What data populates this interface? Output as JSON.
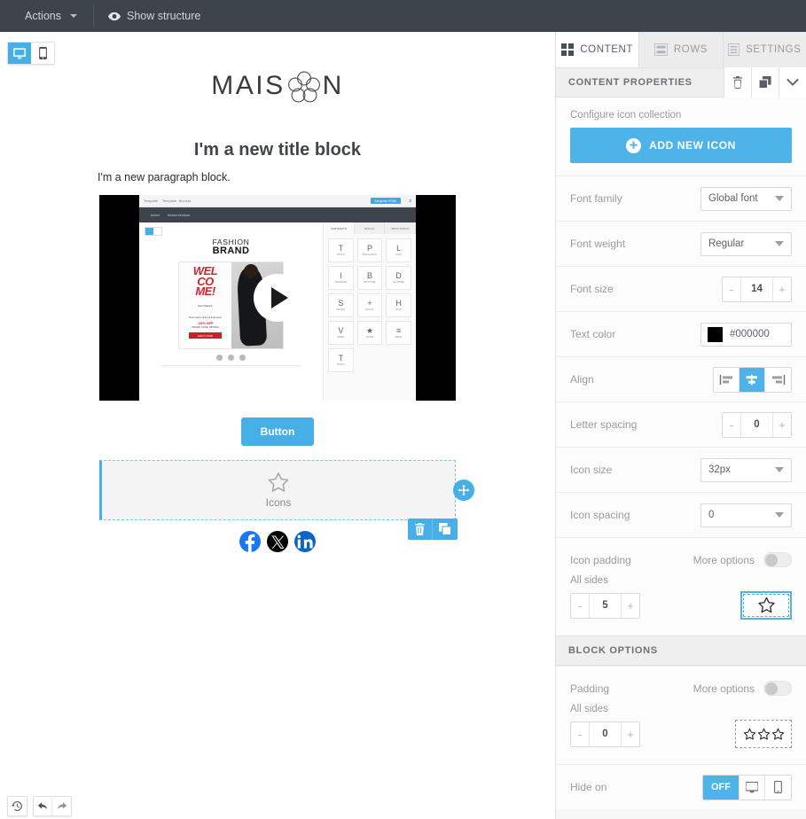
{
  "topbar": {
    "actions_label": "Actions",
    "show_structure_label": "Show structure",
    "actions_icon": "chevron-down-icon",
    "structure_icon": "eye-icon"
  },
  "canvas": {
    "device_toggle": {
      "desktop_label": "desktop-view",
      "mobile_label": "mobile-view",
      "active": "desktop"
    },
    "logo": {
      "text_left": "MAIS",
      "text_right": "N",
      "flower_icon": "flower-logo-icon"
    },
    "title_block": "I'm a new title block",
    "paragraph_block": "I'm a new paragraph block.",
    "video_block": {
      "play_icon": "play-button-icon",
      "inner": {
        "breadcrumb_back": "Template",
        "breadcrumb_current": "Template: Nicosia",
        "source_html_btn": "Sorgente HTML",
        "close_btn": "x",
        "menu_actions": "Azioni",
        "menu_structure": "Mostra struttura",
        "brand_line1": "FASHION",
        "brand_line2": "BRAND",
        "welcome_l1": "WEL",
        "welcome_l2": "CO",
        "welcome_l3": "ME!",
        "promo_sub1": "Dear #Name#,",
        "promo_sub2": "lorem ipsum dolor sit amet enim",
        "promo_off": "-10% OFF",
        "promo_code": "PROMO CODE: NIKOSIA",
        "promo_btn": "ENJOY NOW",
        "tabs": [
          {
            "label": "CONTENUTO",
            "icon": "grid-icon",
            "active": true
          },
          {
            "label": "MODULI",
            "icon": "rows-icon",
            "active": false
          },
          {
            "label": "IMPOSTAZIONI",
            "icon": "settings-icon",
            "active": false
          }
        ],
        "cells": [
          {
            "glyph": "T",
            "label": "TITOLO"
          },
          {
            "glyph": "P",
            "label": "PARAGRAFO"
          },
          {
            "glyph": "L",
            "label": "LISTA"
          },
          {
            "glyph": "I",
            "label": "IMMAGINE"
          },
          {
            "glyph": "B",
            "label": "BOTTONE"
          },
          {
            "glyph": "D",
            "label": "DIVISORE"
          },
          {
            "glyph": "S",
            "label": "SPAZIO"
          },
          {
            "glyph": "+",
            "label": "SOCIAL"
          },
          {
            "glyph": "H",
            "label": "HTML"
          },
          {
            "glyph": "V",
            "label": "VIDEO"
          },
          {
            "glyph": "★",
            "label": "ICONE"
          },
          {
            "glyph": "≡",
            "label": "MENU"
          },
          {
            "glyph": "T",
            "label": "TESTO"
          }
        ]
      }
    },
    "button_block": {
      "label": "Button"
    },
    "icons_block": {
      "placeholder_label": "Icons",
      "star_icon": "star-outline-icon",
      "drag_handle_icon": "move-handle-icon",
      "selected": true
    },
    "social_icons": [
      {
        "name": "facebook-icon",
        "color": "#1877F2"
      },
      {
        "name": "x-twitter-icon",
        "color": "#000000"
      },
      {
        "name": "linkedin-icon",
        "color": "#0A66C2"
      }
    ],
    "mini_toolbar": [
      {
        "name": "delete-block-button",
        "icon": "trash-icon"
      },
      {
        "name": "duplicate-block-button",
        "icon": "copy-icon"
      }
    ],
    "bottom_tools": [
      {
        "name": "history-button",
        "icon": "history-icon"
      },
      {
        "name": "undo-button",
        "icon": "undo-arrow-icon"
      },
      {
        "name": "redo-button",
        "icon": "redo-arrow-icon"
      }
    ]
  },
  "panel": {
    "tabs": [
      {
        "label": "CONTENT",
        "icon": "grid-icon",
        "active": true
      },
      {
        "label": "ROWS",
        "icon": "rows-icon",
        "active": false
      },
      {
        "label": "SETTINGS",
        "icon": "settings-icon",
        "active": false
      }
    ],
    "content_properties": {
      "header": "CONTENT PROPERTIES",
      "header_actions": [
        {
          "name": "delete-content-button",
          "icon": "trash-icon"
        },
        {
          "name": "duplicate-content-button",
          "icon": "copy-icon"
        },
        {
          "name": "collapse-section-button",
          "icon": "chevron-down-icon"
        }
      ],
      "configure_label": "Configure icon collection",
      "add_icon_button": "ADD NEW ICON",
      "add_icon_glyph": "plus-circle-icon",
      "rows": [
        {
          "label": "Font family",
          "type": "select",
          "value": "Global font"
        },
        {
          "label": "Font weight",
          "type": "select",
          "value": "Regular"
        },
        {
          "label": "Font size",
          "type": "stepper",
          "value": "14",
          "minus": "-",
          "plus": "+"
        },
        {
          "label": "Text color",
          "type": "color",
          "value": "#000000",
          "swatch": "#000000"
        },
        {
          "label": "Align",
          "type": "align",
          "value": "center",
          "options": [
            "align-left",
            "align-center",
            "align-right"
          ]
        },
        {
          "label": "Letter spacing",
          "type": "stepper",
          "value": "0",
          "minus": "-",
          "plus": "+"
        },
        {
          "label": "Icon size",
          "type": "select",
          "value": "32px"
        },
        {
          "label": "Icon spacing",
          "type": "select",
          "value": "0"
        }
      ],
      "icon_padding": {
        "label": "Icon padding",
        "more_options_label": "More options",
        "more_options_on": false,
        "all_sides_label": "All sides",
        "value": "5",
        "minus": "-",
        "plus": "+",
        "preview_icon": "star-outline-icon"
      }
    },
    "block_options": {
      "header": "BLOCK OPTIONS",
      "padding": {
        "label": "Padding",
        "more_options_label": "More options",
        "more_options_on": false,
        "all_sides_label": "All sides",
        "value": "0",
        "minus": "-",
        "plus": "+",
        "preview_icon": "three-stars-icon"
      },
      "hide_on": {
        "label": "Hide on",
        "off_label": "OFF",
        "desktop_icon": "desktop-icon",
        "mobile_icon": "mobile-icon",
        "active": "OFF"
      }
    }
  },
  "colors": {
    "accent": "#4eb3e8",
    "topbar": "#3e444c",
    "panel_bg": "#f7f7f7",
    "text_muted": "#9b9b9b"
  }
}
